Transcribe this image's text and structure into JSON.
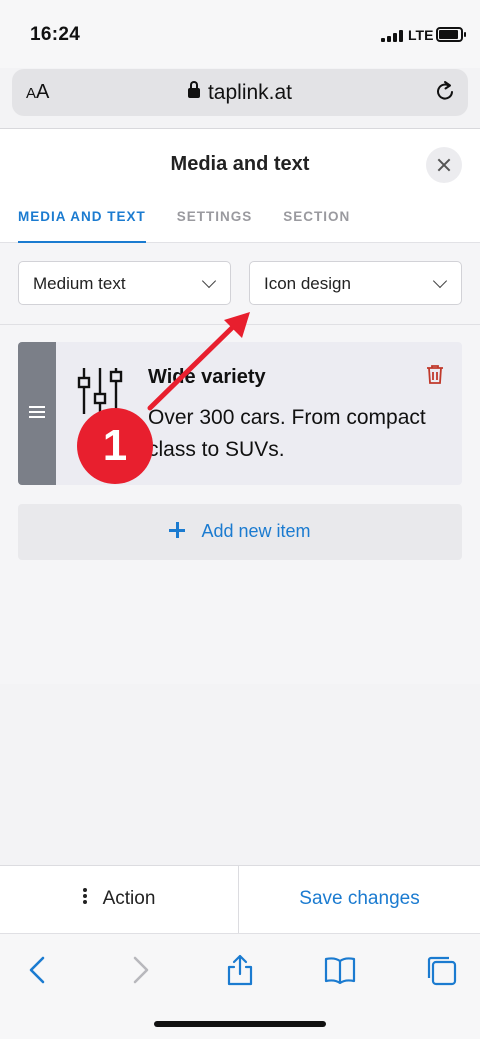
{
  "status_bar": {
    "time": "16:24",
    "network": "LTE"
  },
  "browser": {
    "text_size_label_small": "A",
    "text_size_label_large": "A",
    "url": "taplink.at"
  },
  "panel": {
    "title": "Media and text",
    "tabs": [
      {
        "label": "MEDIA AND TEXT",
        "active": true
      },
      {
        "label": "SETTINGS",
        "active": false
      },
      {
        "label": "SECTION",
        "active": false
      }
    ],
    "text_size_select": "Medium text",
    "design_select": "Icon design",
    "item": {
      "title": "Wide variety",
      "description": "Over 300 cars. From compact class to SUVs.",
      "icon": "sliders-icon"
    },
    "add_item_label": "Add new item"
  },
  "annotation": {
    "step_number": "1",
    "color": "#e81f2e"
  },
  "action_bar": {
    "action_label": "Action",
    "save_label": "Save changes"
  },
  "colors": {
    "accent": "#1b7bd0",
    "delete": "#c0392b"
  }
}
